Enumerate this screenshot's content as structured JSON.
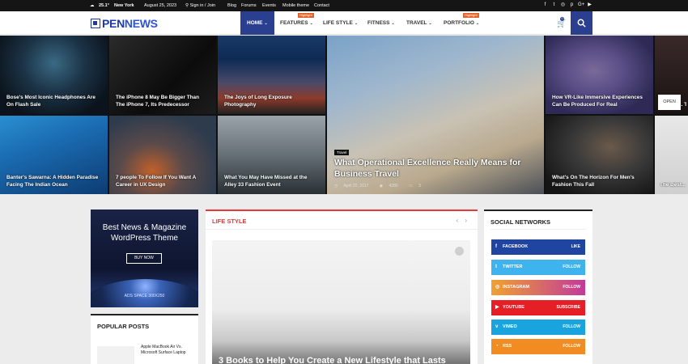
{
  "topbar": {
    "weather_icon": "cloud-icon",
    "temp": "25.1°",
    "city": "New York",
    "date": "August 25, 2023",
    "sign_in": "Sign in / Join",
    "links": [
      "Blog",
      "Forums",
      "Events",
      "Mobile theme",
      "Contact"
    ],
    "social_icons": [
      "facebook-icon",
      "twitter-icon",
      "instagram-icon",
      "pinterest-icon",
      "google-plus-icon",
      "youtube-icon"
    ]
  },
  "header": {
    "logo_left": "PEN",
    "logo_right": "NEWS",
    "nav": [
      {
        "label": "HOME",
        "badge": ""
      },
      {
        "label": "FEATURES",
        "badge": "Highlight"
      },
      {
        "label": "LIFE STYLE",
        "badge": ""
      },
      {
        "label": "FITNESS",
        "badge": ""
      },
      {
        "label": "TRAVEL",
        "badge": ""
      },
      {
        "label": "PORTFOLIO",
        "badge": "Highlight"
      }
    ],
    "cart_count": "0",
    "accent": "#2a3f8f"
  },
  "grid": {
    "tiles": [
      "Bose's Most Iconic Headphones Are On Flash Sale",
      "The iPhone 8 May Be Bigger Than The iPhone 7, Its Predecessor",
      "The Joys of Long Exposure Photography",
      "How VR-Like Immersive Experiences Can Be Produced For Real",
      "Build M... Tweak t...",
      "Banter's Sawarna: A Hidden Paradise Facing The Indian Ocean",
      "7 people To Follow If You Want A Career in UX Design",
      "What You May Have Missed at the Alley 33 Fashion Event",
      "What's On The Horizon For Men's Fashion This Fall",
      "The Best... Tight H..."
    ],
    "featured": {
      "tag": "Travel",
      "title": "What Operational Excellence Really Means for Business Travel",
      "date": "April 20, 2017",
      "views": "4280",
      "comments": "3"
    },
    "open_label": "OPEN"
  },
  "ad": {
    "title_line1": "Best News & Magazine",
    "title_line2": "WordPress Theme",
    "button": "BUY NOW",
    "label": "ADS SPACE 300X250"
  },
  "popular": {
    "title": "POPULAR POSTS",
    "item": "Apple MacBook Air Vs. Microsoft Surface Laptop"
  },
  "lifestyle": {
    "title": "LIFE STYLE",
    "arrows": "‹ ›",
    "caption": "3 Books to Help You Create a New Lifestyle that Lasts",
    "accent": "#e63838"
  },
  "social": {
    "title": "SOCIAL NETWORKS",
    "rows": [
      {
        "name": "FACEBOOK",
        "action": "LIKE",
        "icon": "facebook-icon",
        "color": "#1f45a0"
      },
      {
        "name": "TWITTER",
        "action": "FOLLOW",
        "icon": "twitter-icon",
        "color": "#3fb3ee"
      },
      {
        "name": "INSTAGRAM",
        "action": "FOLLOW",
        "icon": "instagram-icon",
        "color": "#c23a9a"
      },
      {
        "name": "YOUTUBE",
        "action": "SUBSCRIBE",
        "icon": "youtube-icon",
        "color": "#e61f26"
      },
      {
        "name": "VIMEO",
        "action": "FOLLOW",
        "icon": "vimeo-icon",
        "color": "#19a4df"
      },
      {
        "name": "RSS",
        "action": "FOLLOW",
        "icon": "rss-icon",
        "color": "#f08c21"
      }
    ]
  }
}
